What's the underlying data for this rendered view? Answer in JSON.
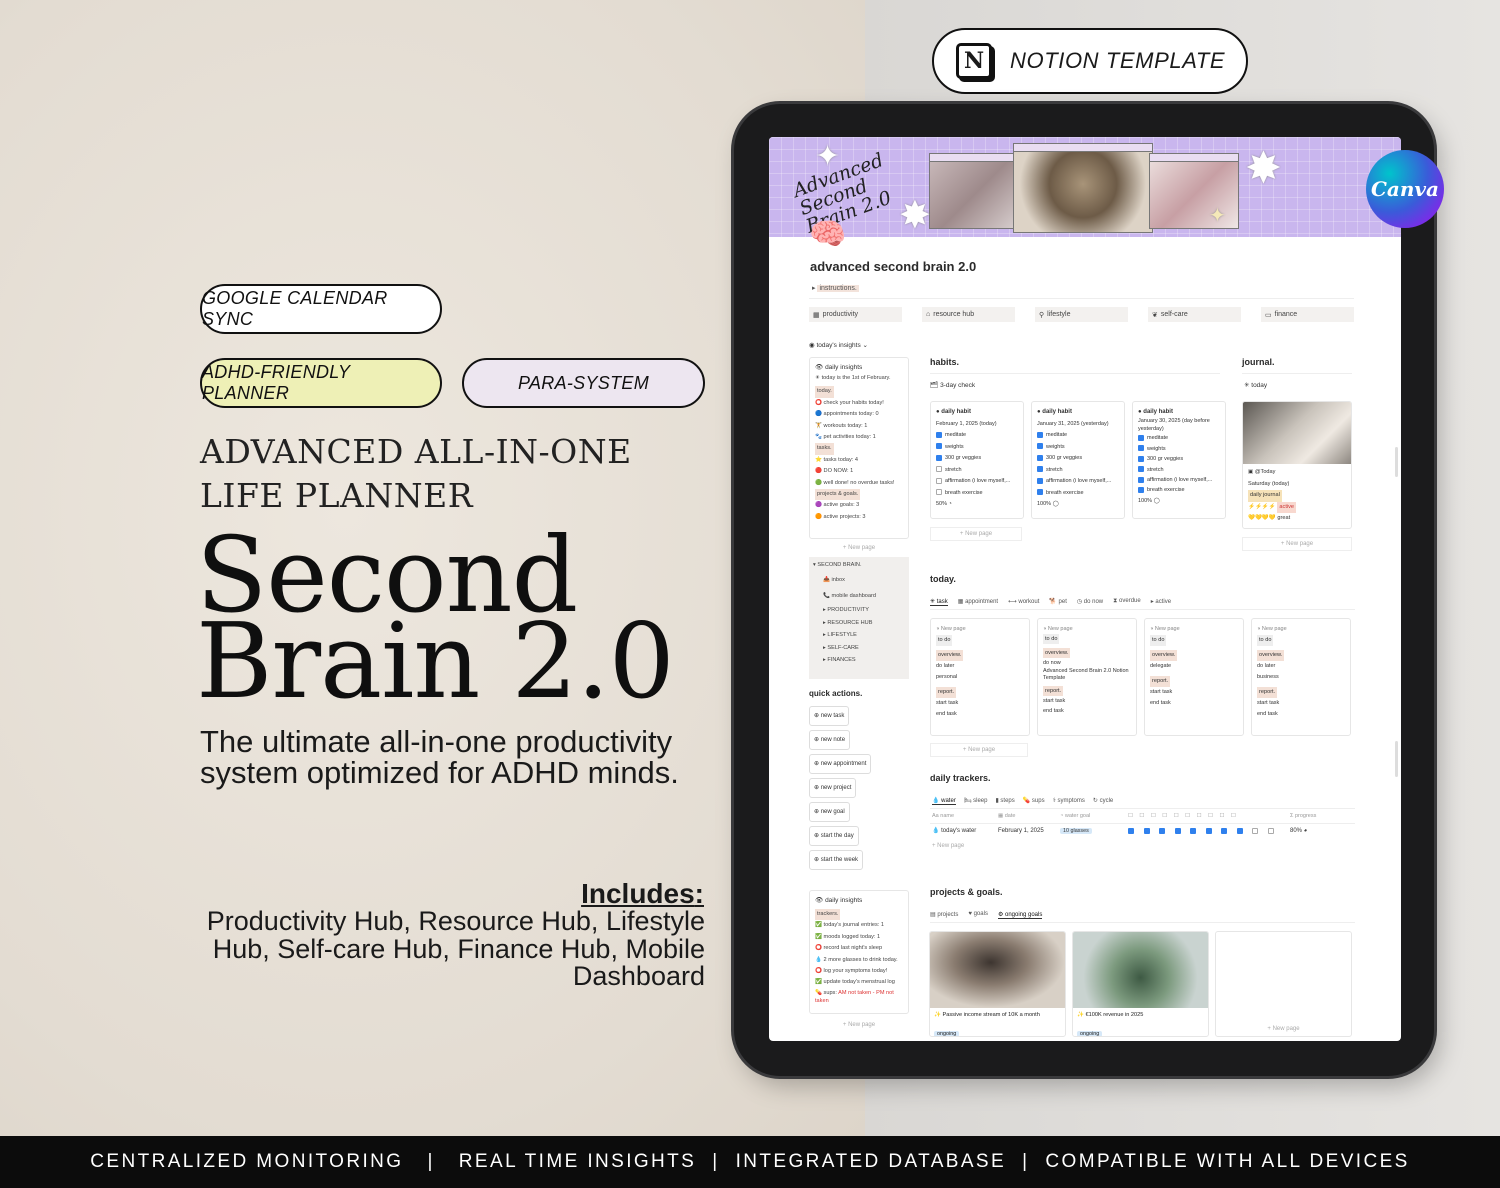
{
  "badges": {
    "google_calendar": "GOOGLE CALENDAR SYNC",
    "adhd": "ADHD-FRIENDLY PLANNER",
    "para": "PARA-SYSTEM",
    "notion": "NOTION TEMPLATE",
    "canva": "Canva"
  },
  "colors": {
    "adhd_badge_bg": "#eef0b6",
    "para_badge_bg": "#ede6f0",
    "footer_bg": "#0c0c0c",
    "cover_bg": "#c9b6ee"
  },
  "headline": {
    "line1": "ADVANCED ALL-IN-ONE",
    "line2": "LIFE PLANNER",
    "title1": "Second",
    "title2": "Brain 2.0",
    "subtitle": "The ultimate all-in-one productivity system optimized for ADHD minds."
  },
  "includes": {
    "title": "Includes",
    "colon": ":",
    "list": "Productivity Hub, Resource Hub, Lifestyle Hub, Self-care Hub, Finance Hub, Mobile Dashboard"
  },
  "footer": {
    "items": [
      "CENTRALIZED MONITORING",
      "REAL TIME INSIGHTS",
      "INTEGRATED DATABASE",
      "COMPATIBLE WITH ALL DEVICES"
    ],
    "separator": "|"
  },
  "notion": {
    "cover_script": "Advanced Second Brain 2.0",
    "page_title": "advanced second brain 2.0",
    "instructions": "instructions.",
    "hubs": [
      "productivity",
      "resource hub",
      "lifestyle",
      "self-care",
      "finance"
    ],
    "sidebar": {
      "insights_toggle": "today's insights",
      "daily_insights": "daily insights",
      "today_line": "today is the 1st of February.",
      "today_tag": "today.",
      "today_items": [
        "check your habits today!",
        "appointments today: 0",
        "workouts today: 1",
        "pet activities today: 1"
      ],
      "tasks_tag": "tasks.",
      "tasks_items": [
        "tasks today: 4",
        "DO NOW: 1",
        "well done! no overdue tasks!"
      ],
      "projects_tag": "projects & goals.",
      "projects_items": [
        "active goals: 3",
        "active projects: 3"
      ],
      "new_page": "New page",
      "menu_header": "SECOND BRAIN.",
      "menu_links": [
        "inbox",
        "mobile dashboard"
      ],
      "menu_items": [
        "PRODUCTIVITY",
        "RESOURCE HUB",
        "LIFESTYLE",
        "SELF-CARE",
        "FINANCES"
      ],
      "quick_actions_title": "quick actions.",
      "quick_actions": [
        "new task",
        "new note",
        "new appointment",
        "new project",
        "new goal",
        "start the day",
        "start the week"
      ],
      "daily_insights2": "daily insights",
      "trackers_tag": "trackers.",
      "trackers_items": [
        "today's journal entries: 1",
        "moods logged today: 1",
        "record last night's sleep",
        "2 more glasses to drink today.",
        "log your symptoms today!",
        "update today's menstrual log"
      ],
      "sups_label": "sups:",
      "sups_value": "AM not taken - PM not taken"
    },
    "habits": {
      "title": "habits.",
      "check": "3-day check",
      "cards": [
        {
          "name": "daily habit",
          "date": "February 1, 2025 (today)",
          "items": [
            "meditate",
            "weights",
            "300 gr veggies",
            "stretch",
            "affirmation (i love myself,...",
            "breath exercise"
          ],
          "checked": [
            true,
            true,
            true,
            false,
            false,
            false
          ],
          "pct": "50%"
        },
        {
          "name": "daily habit",
          "date": "January 31, 2025 (yesterday)",
          "items": [
            "meditate",
            "weights",
            "300 gr veggies",
            "stretch",
            "affirmation (i love myself,...",
            "breath exercise"
          ],
          "checked": [
            true,
            true,
            true,
            true,
            true,
            true
          ],
          "pct": "100%"
        },
        {
          "name": "daily habit",
          "date": "January 30, 2025 (day before yesterday)",
          "items": [
            "meditate",
            "weights",
            "300 gr veggies",
            "stretch",
            "affirmation (i love myself,...",
            "breath exercise"
          ],
          "checked": [
            true,
            true,
            true,
            true,
            true,
            true
          ],
          "pct": "100%"
        }
      ],
      "new_page": "New page"
    },
    "journal": {
      "title": "journal.",
      "today_tab": "today",
      "entry_label": "@Today",
      "date": "Saturday (today)",
      "tag": "daily journal",
      "status": "active",
      "mood": "great",
      "new_page": "New page"
    },
    "today": {
      "title": "today.",
      "tabs": [
        "task",
        "appointment",
        "workout",
        "pet",
        "do now",
        "overdue",
        "active"
      ],
      "cards": [
        {
          "name": "New page",
          "status": "to do",
          "overview": "overview.",
          "ov_items": [
            "do later",
            "personal"
          ],
          "report": "report.",
          "rep_items": [
            "start task",
            "end task"
          ]
        },
        {
          "name": "New page",
          "status": "to do",
          "overview": "overview.",
          "ov_items": [
            "do now",
            "Advanced Second Brain 2.0 Notion Template"
          ],
          "report": "report.",
          "rep_items": [
            "start task",
            "end task"
          ]
        },
        {
          "name": "New page",
          "status": "to do",
          "overview": "overview.",
          "ov_items": [
            "delegate"
          ],
          "report": "report.",
          "rep_items": [
            "start task",
            "end task"
          ]
        },
        {
          "name": "New page",
          "status": "to do",
          "overview": "overview.",
          "ov_items": [
            "do later",
            "business"
          ],
          "report": "report.",
          "rep_items": [
            "start task",
            "end task"
          ]
        }
      ],
      "new_page": "New page"
    },
    "trackers": {
      "title": "daily trackers.",
      "tabs": [
        "water",
        "sleep",
        "steps",
        "sups",
        "symptoms",
        "cycle"
      ],
      "cols": [
        "name",
        "date",
        "water goal",
        "progress"
      ],
      "row": {
        "name": "today's water",
        "date": "February 1, 2025",
        "goal": "10 glasses",
        "progress": 0.8,
        "progress_label": "80%",
        "checks": [
          true,
          true,
          true,
          true,
          true,
          true,
          true,
          true,
          false,
          false
        ]
      },
      "new_page": "New page"
    },
    "projects": {
      "title": "projects & goals.",
      "tabs": [
        "projects",
        "goals",
        "ongoing goals"
      ],
      "cards": [
        {
          "title": "Passive income stream of 10K a month",
          "status": "ongoing"
        },
        {
          "title": "€100K revenue in 2025",
          "status": "ongoing"
        }
      ],
      "new_page": "New page"
    }
  }
}
